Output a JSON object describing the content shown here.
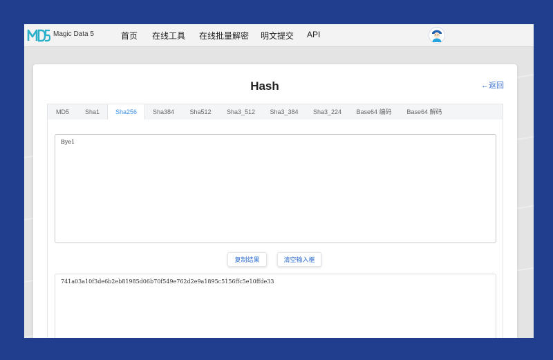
{
  "nav": {
    "brand": "Magic Data 5",
    "items": [
      "首页",
      "在线工具",
      "在线批量解密",
      "明文提交",
      "API"
    ]
  },
  "page": {
    "title": "Hash",
    "back_link": "←返回"
  },
  "tabs": {
    "items": [
      "MD5",
      "Sha1",
      "Sha256",
      "Sha384",
      "Sha512",
      "Sha3_512",
      "Sha3_384",
      "Sha3_224",
      "Base64 编码",
      "Base64 解码"
    ],
    "active": "Sha256"
  },
  "input": {
    "value": "Bye1"
  },
  "buttons": {
    "copy_result": "复制结果",
    "clear_input": "清空输入框"
  },
  "output": {
    "value": "741a03a10f3de6b2eb81985d06b70f549e762d2e9a1895c5156ffc5e10ffde33"
  },
  "colors": {
    "page_bg": "#213e8e",
    "accent": "#3a8ee6",
    "link": "#3a74d4"
  }
}
